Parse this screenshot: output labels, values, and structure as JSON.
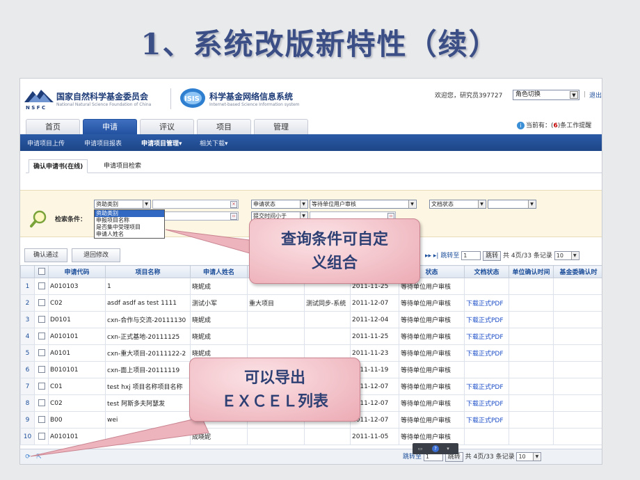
{
  "slide": {
    "title": "1、系统改版新特性（续）"
  },
  "header": {
    "org_cn": "国家自然科学基金委员会",
    "org_en": "National Natural Science Foundation of China",
    "nsfc_letters": "N S F C",
    "isis_text": "ISIS",
    "sys_cn": "科学基金网络信息系统",
    "sys_en": "Internet-based Science Information system",
    "welcome": "欢迎您，研究员397727",
    "role_label": "角色切换",
    "logout": "退出",
    "sep": "|"
  },
  "tabs": [
    "首页",
    "申请",
    "评议",
    "项目",
    "管理"
  ],
  "active_tab": "申请",
  "notice": {
    "prefix": "当前有：(",
    "count": "6",
    "suffix": ")条工作提醒"
  },
  "subnav": [
    "申请项目上传",
    "申请项目报表",
    "申请项目管理▾",
    "相关下载▾"
  ],
  "subtabs": [
    "确认申请书(在线)",
    "申请项目检索"
  ],
  "search": {
    "label": "检索条件：",
    "select1": "资助类别",
    "select2": "申请状态",
    "select2_value": "等待单位用户审核",
    "select3": "提交时间小于",
    "select4": "文档状态",
    "dropdown_options": [
      "资助类别",
      "申报项目名称",
      "是否集中受理项目",
      "申请人姓名"
    ]
  },
  "actions": {
    "confirm": "确认通过",
    "reject": "退回修改"
  },
  "pager": {
    "nav": "▸▸ ▸|",
    "jump_to": "跳转至",
    "page_input": "1",
    "jump_btn": "跳转",
    "summary": "共 4页/33 条记录",
    "page_size": "10"
  },
  "table": {
    "headers": [
      "申请代码",
      "项目名称",
      "申请人姓名",
      "",
      "",
      "",
      "状态",
      "文档状态",
      "单位确认时间",
      "基金委确认时"
    ],
    "rows": [
      {
        "no": "1",
        "code": "A010103",
        "name": "1",
        "person": "晓妮成",
        "type": "",
        "org": "",
        "date": "2011-11-25",
        "status": "等待单位用户审核",
        "doc": ""
      },
      {
        "no": "2",
        "code": "C02",
        "name": "asdf asdf as test 1111",
        "person": "测试小军",
        "type": "重大项目",
        "org": "测试同步-系统",
        "date": "2011-12-07",
        "status": "等待单位用户审核",
        "doc": "下载正式PDF"
      },
      {
        "no": "3",
        "code": "D0101",
        "name": "cxn-合作与交流-20111130",
        "person": "晓妮成",
        "type": "",
        "org": "",
        "date": "2011-12-04",
        "status": "等待单位用户审核",
        "doc": "下载正式PDF"
      },
      {
        "no": "4",
        "code": "A010101",
        "name": "cxn-正式基地-20111125",
        "person": "晓妮成",
        "type": "",
        "org": "",
        "date": "2011-11-25",
        "status": "等待单位用户审核",
        "doc": "下载正式PDF"
      },
      {
        "no": "5",
        "code": "A0101",
        "name": "cxn-重大项目-20111122-2",
        "person": "晓妮成",
        "type": "",
        "org": "",
        "date": "2011-11-23",
        "status": "等待单位用户审核",
        "doc": "下载正式PDF"
      },
      {
        "no": "6",
        "code": "B010101",
        "name": "cxn-面上项目-20111119",
        "person": "",
        "type": "",
        "org": "",
        "date": "2011-11-19",
        "status": "等待单位用户审核",
        "doc": ""
      },
      {
        "no": "7",
        "code": "C01",
        "name": "test hxj 项目名称项目名称",
        "person": "",
        "type": "",
        "org": "",
        "date": "2011-12-07",
        "status": "等待单位用户审核",
        "doc": "下载正式PDF"
      },
      {
        "no": "8",
        "code": "C02",
        "name": "test 阿斯多夫阿瑟发",
        "person": "",
        "type": "",
        "org": "",
        "date": "2011-12-07",
        "status": "等待单位用户审核",
        "doc": "下载正式PDF"
      },
      {
        "no": "9",
        "code": "B00",
        "name": "wei",
        "person": "",
        "type": "",
        "org": "",
        "date": "2011-12-07",
        "status": "等待单位用户审核",
        "doc": "下载正式PDF"
      },
      {
        "no": "10",
        "code": "A010101",
        "name": "",
        "person": "成晓妮",
        "type": "",
        "org": "",
        "date": "2011-11-05",
        "status": "等待单位用户审核",
        "doc": ""
      }
    ]
  },
  "callouts": {
    "c1_line1": "查询条件可自定",
    "c1_line2": "义组合",
    "c2_line1": "可以导出",
    "c2_line2": "ＥＸＣＥＬ列表"
  },
  "colors": {
    "title": "#3b4f86",
    "nav_blue": "#21509f",
    "callout_fill": "#f3c3cb",
    "pdf_link": "#1c4ec8"
  }
}
